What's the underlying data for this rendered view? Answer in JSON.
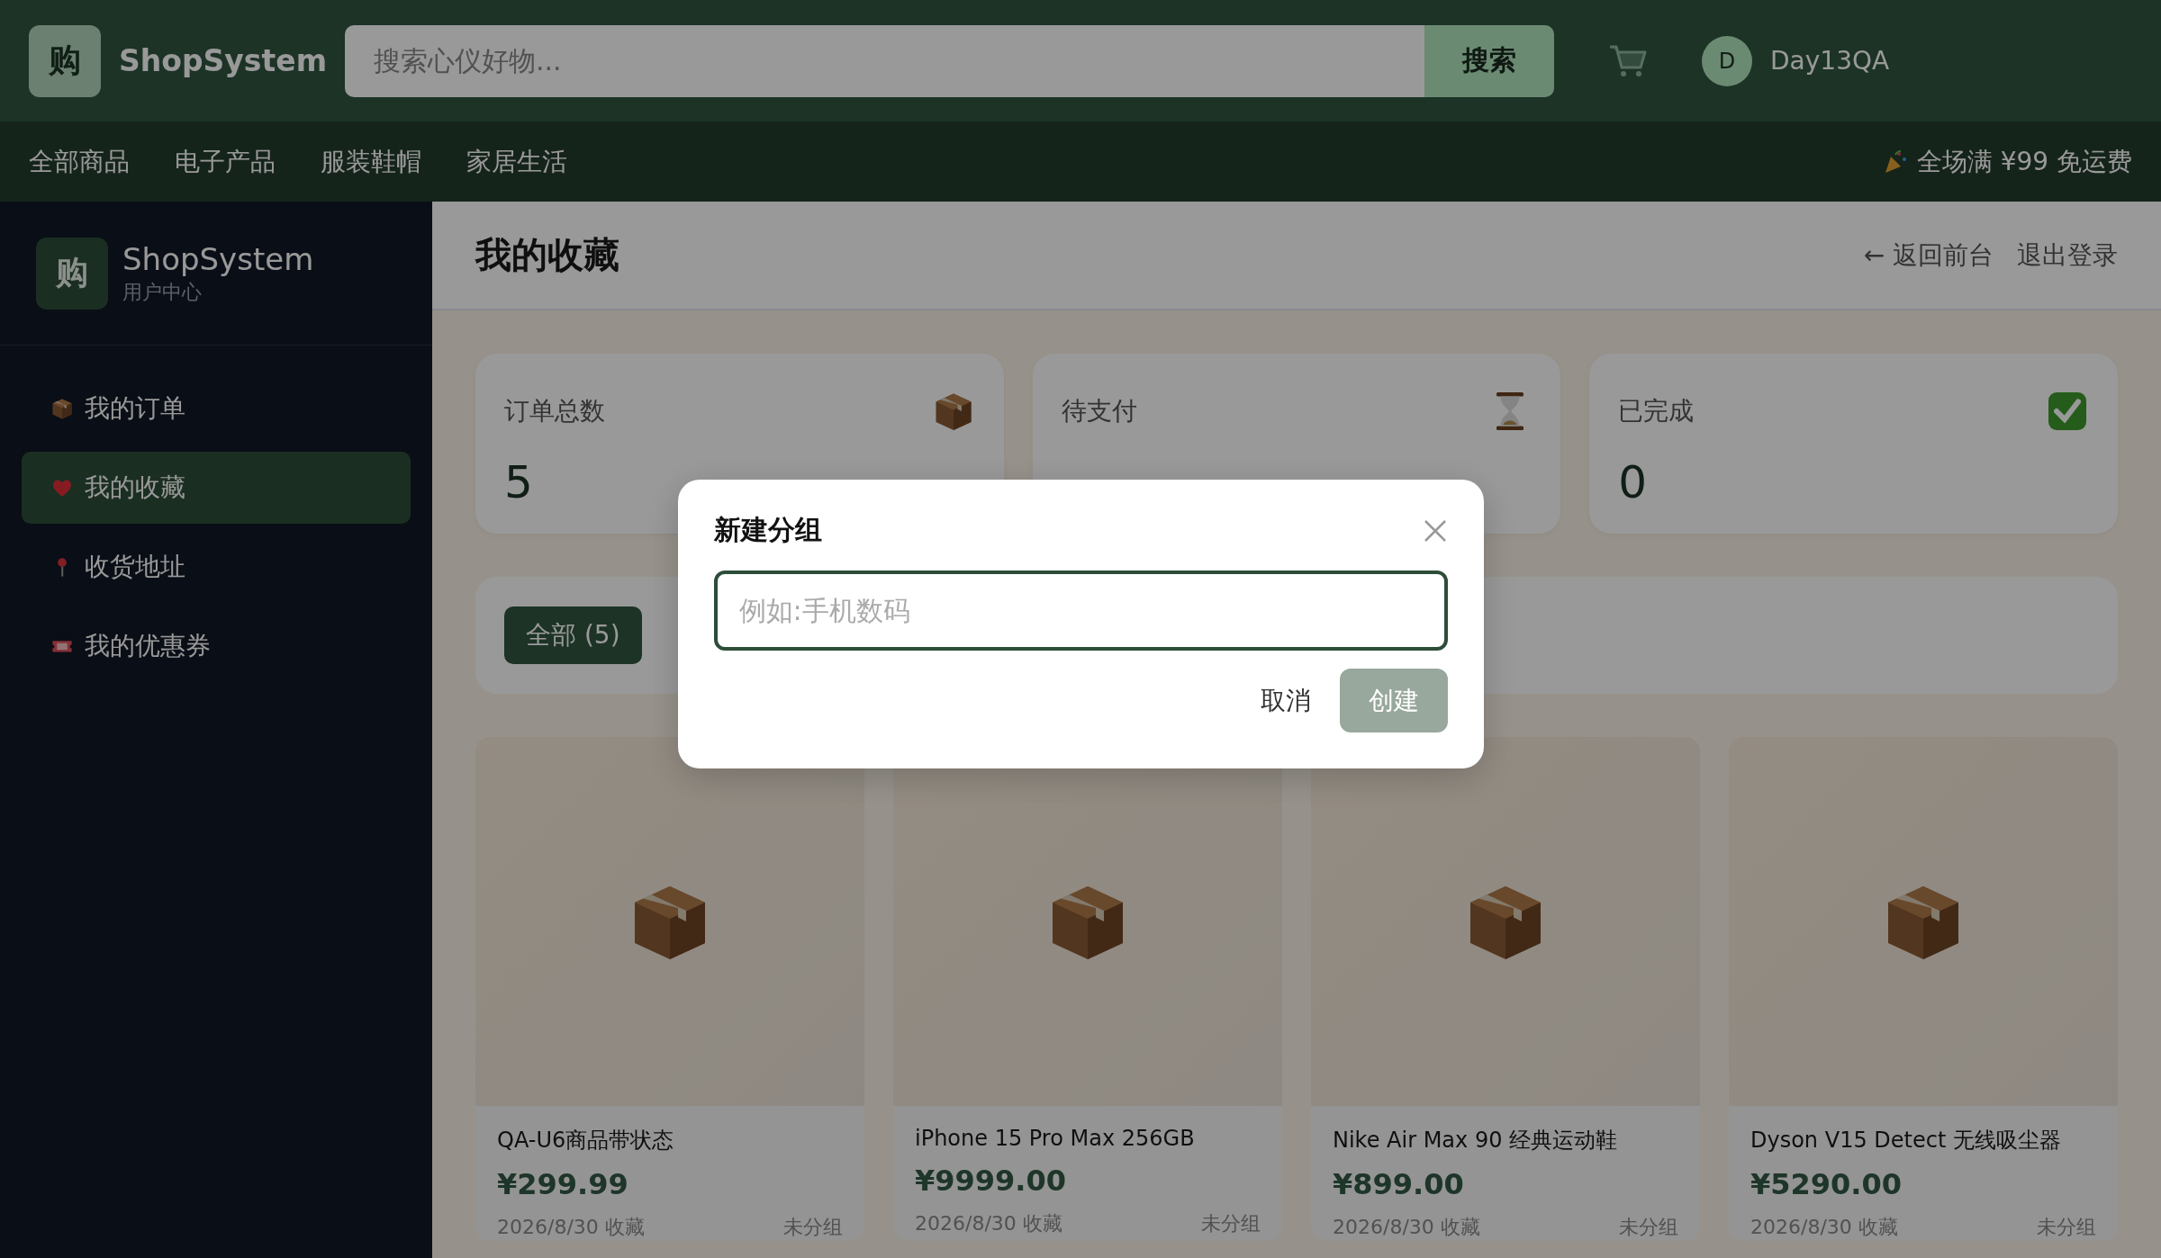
{
  "header": {
    "logo_mark": "购",
    "brand": "ShopSystem",
    "search": {
      "placeholder": "搜索心仪好物...",
      "button": "搜索"
    },
    "user": {
      "avatar": "D",
      "name": "Day13QA"
    }
  },
  "nav": {
    "items": [
      "全部商品",
      "电子产品",
      "服装鞋帽",
      "家居生活"
    ],
    "promo": "全场满 ¥99 免运费"
  },
  "sidebar": {
    "logo_mark": "购",
    "brand": "ShopSystem",
    "subtitle": "用户中心",
    "items": [
      {
        "label": "我的订单",
        "selected": false
      },
      {
        "label": "我的收藏",
        "selected": true
      },
      {
        "label": "收货地址",
        "selected": false
      },
      {
        "label": "我的优惠券",
        "selected": false
      }
    ]
  },
  "page": {
    "title": "我的收藏",
    "links": [
      "← 返回前台",
      "退出登录"
    ]
  },
  "stats": [
    {
      "label": "订单总数",
      "value": "5"
    },
    {
      "label": "待支付"
    },
    {
      "label": "已完成",
      "value": "0"
    }
  ],
  "filters": [
    {
      "label": "全部 (5)",
      "selected": true
    }
  ],
  "products": [
    {
      "name": "QA-U6商品带状态",
      "price": "¥299.99",
      "date": "2026/8/30 收藏",
      "group": "未分组"
    },
    {
      "name": "iPhone 15 Pro Max 256GB",
      "price": "¥9999.00",
      "date": "2026/8/30 收藏",
      "group": "未分组"
    },
    {
      "name": "Nike Air Max 90 经典运动鞋",
      "price": "¥899.00",
      "date": "2026/8/30 收藏",
      "group": "未分组"
    },
    {
      "name": "Dyson V15 Detect 无线吸尘器",
      "price": "¥5290.00",
      "date": "2026/8/30 收藏",
      "group": "未分组"
    }
  ],
  "dialog": {
    "title": "新建分组",
    "input": {
      "placeholder": "例如:手机数码"
    },
    "buttons": [
      {
        "label": "取消",
        "kind": "secondary"
      },
      {
        "label": "创建",
        "kind": "primary"
      }
    ]
  }
}
